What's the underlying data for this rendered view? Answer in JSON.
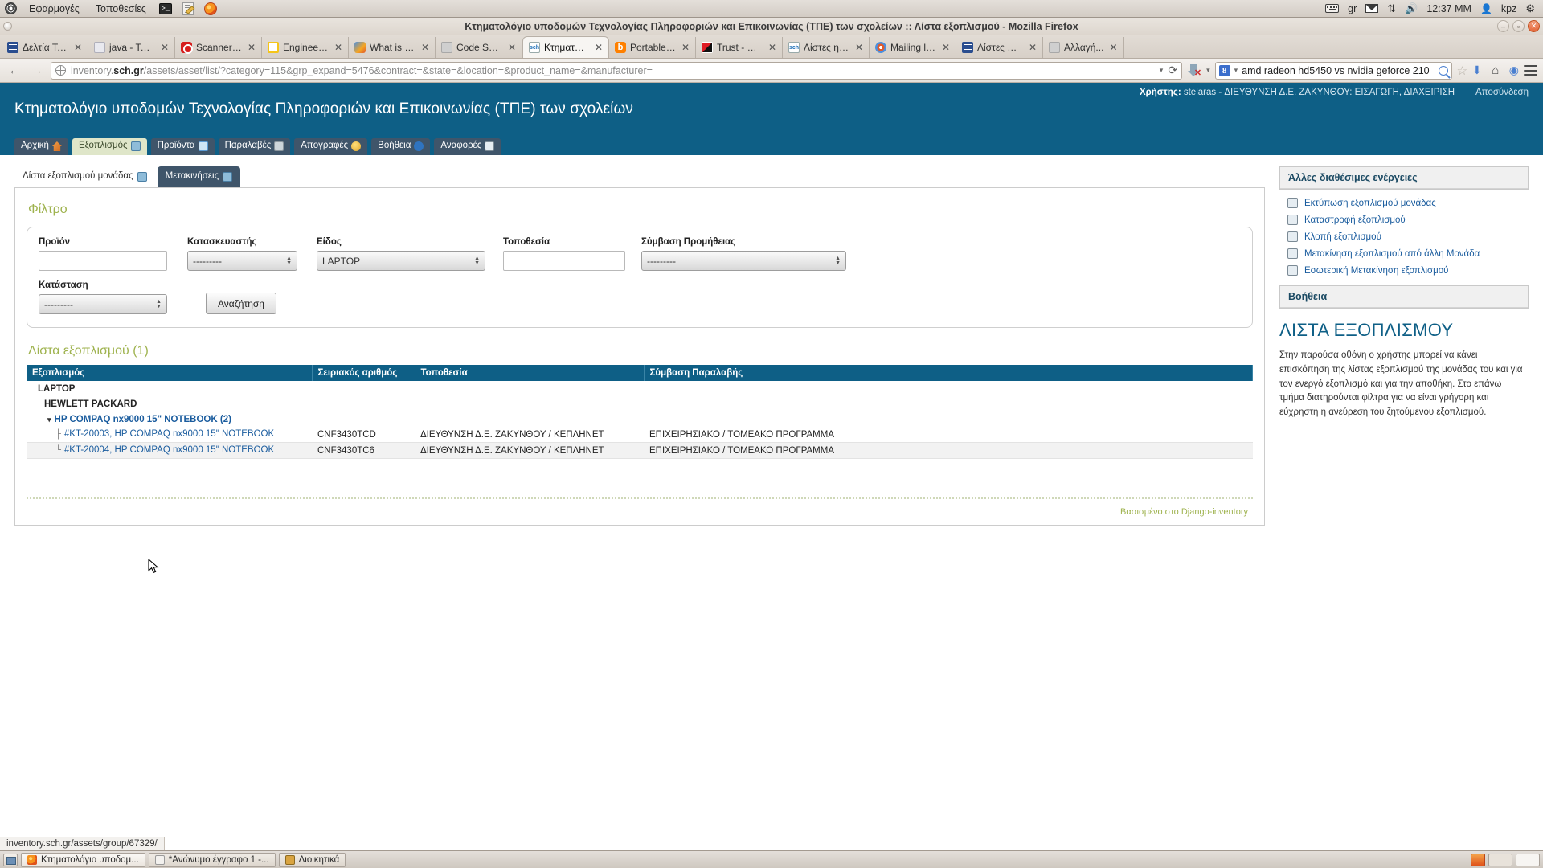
{
  "gnome_panel": {
    "menus": [
      "Εφαρμογές",
      "Τοποθεσίες"
    ],
    "launchers": [
      "terminal-icon",
      "gedit-icon",
      "firefox-icon"
    ],
    "tray": {
      "keyboard_layout": "gr",
      "clock": "12:37 ΜΜ",
      "user": "kpz",
      "icons": [
        "keyboard-icon",
        "mail-icon",
        "network-icon",
        "volume-icon",
        "user-icon",
        "gear-icon"
      ]
    }
  },
  "window": {
    "title": "Κτηματολόγιο υποδομών Τεχνολογίας Πληροφοριών και Επικοινωνίας (ΤΠΕ) των σχολείων :: Λίστα εξοπλισμού - Mozilla Firefox",
    "controls": [
      "minimize",
      "maximize",
      "close"
    ]
  },
  "tabs": [
    {
      "label": "Δελτία Τε...",
      "favicon": "fav-news",
      "active": false
    },
    {
      "label": "java - Take...",
      "favicon": "fav-java",
      "active": false
    },
    {
      "label": "Scanner (J...",
      "favicon": "fav-red",
      "active": false
    },
    {
      "label": "Engineeri...",
      "favicon": "fav-yellow",
      "active": false
    },
    {
      "label": "What is Jo...",
      "favicon": "fav-joomla",
      "active": false
    },
    {
      "label": "Code School -...",
      "favicon": "fav-gray",
      "active": false
    },
    {
      "label": "Κτηματολόγι...",
      "favicon": "fav-sch",
      "active": true
    },
    {
      "label": "Portable ...",
      "favicon": "fav-blogger",
      "active": false
    },
    {
      "label": "Trust - Dig...",
      "favicon": "fav-trust",
      "active": false
    },
    {
      "label": "Λίστες ηλε...",
      "favicon": "fav-sch",
      "active": false
    },
    {
      "label": "Mailing lis...",
      "favicon": "fav-mailman",
      "active": false
    },
    {
      "label": "Λίστες Ηλ...",
      "favicon": "fav-news",
      "active": false
    },
    {
      "label": "Αλλαγή...",
      "favicon": "fav-gray",
      "active": false
    }
  ],
  "tab_close_glyph": "✕",
  "navbar": {
    "back_glyph": "←",
    "forward_glyph": "→",
    "url_prefix": "inventory.",
    "url_domain": "sch.gr",
    "url_suffix": "/assets/asset/list/?category=115&grp_expand=5476&contract=&state=&location=&product_name=&manufacturer=",
    "url_dropdown_glyph": "▾",
    "reload_glyph": "⟳",
    "search_engine": "8",
    "search_value": "amd radeon hd5450 vs nvidia geforce 210",
    "bookmark_glyph": "☆",
    "home_glyph": "⌂",
    "menu_glyph": "≡"
  },
  "app": {
    "title": "Κτηματολόγιο υποδομών Τεχνολογίας Πληροφοριών και Επικοινωνίας (ΤΠΕ) των σχολείων",
    "user_label": "Χρήστης:",
    "user_value": "stelaras - ΔΙΕΥΘΥΝΣΗ Δ.Ε. ΖΑΚΥΝΘΟΥ: ΕΙΣΑΓΩΓΗ, ΔΙΑΧΕΙΡΙΣΗ",
    "logout": "Αποσύνδεση",
    "nav": [
      {
        "label": "Αρχική",
        "icon": "home-icon",
        "icon_class": "mic-home",
        "active": false
      },
      {
        "label": "Εξοπλισμός",
        "icon": "equipment-icon",
        "icon_class": "mic-eq",
        "active": true
      },
      {
        "label": "Προϊόντα",
        "icon": "products-icon",
        "icon_class": "mic-prod",
        "active": false
      },
      {
        "label": "Παραλαβές",
        "icon": "deliveries-icon",
        "icon_class": "mic-del",
        "active": false
      },
      {
        "label": "Απογραφές",
        "icon": "inventory-icon",
        "icon_class": "mic-inv",
        "active": false
      },
      {
        "label": "Βοήθεια",
        "icon": "help-icon",
        "icon_class": "mic-help",
        "active": false
      },
      {
        "label": "Αναφορές",
        "icon": "reports-icon",
        "icon_class": "mic-rep",
        "active": false
      }
    ]
  },
  "subtabs": [
    {
      "label": "Λίστα εξοπλισμού μονάδας",
      "icon": "equipment-list-icon",
      "selected": false
    },
    {
      "label": "Μετακινήσεις",
      "icon": "transfers-icon",
      "selected": true
    }
  ],
  "filter": {
    "heading": "Φίλτρο",
    "fields": [
      {
        "name": "product",
        "label": "Προϊόν",
        "type": "text",
        "value": ""
      },
      {
        "name": "manufacturer",
        "label": "Κατασκευαστής",
        "type": "select",
        "value": "---------"
      },
      {
        "name": "kind",
        "label": "Είδος",
        "type": "select",
        "value": "LAPTOP"
      },
      {
        "name": "location",
        "label": "Τοποθεσία",
        "type": "text",
        "value": ""
      },
      {
        "name": "supply-contract",
        "label": "Σύμβαση Προμήθειας",
        "type": "select",
        "value": "---------"
      },
      {
        "name": "state",
        "label": "Κατάσταση",
        "type": "select",
        "value": "---------"
      }
    ],
    "submit_label": "Αναζήτηση"
  },
  "list": {
    "heading": "Λίστα εξοπλισμού (1)",
    "columns": [
      "Εξοπλισμός",
      "Σειριακός αριθμός",
      "Τοποθεσία",
      "Σύμβαση Παραλαβής"
    ],
    "group_kind": "LAPTOP",
    "group_manufacturer": "HEWLETT PACKARD",
    "group_product": "HP COMPAQ nx9000 15\" NOTEBOOK (2)",
    "group_caret": "▾",
    "rows": [
      {
        "name": "#KT-20003, HP COMPAQ nx9000 15\" NOTEBOOK",
        "serial": "CNF3430TCD",
        "location": "ΔΙΕΥΘΥΝΣΗ Δ.Ε. ΖΑΚΥΝΘΟΥ / ΚΕΠΛΗΝΕΤ",
        "contract": "ΕΠΙΧΕΙΡΗΣΙΑΚΟ / ΤΟΜΕΑΚΟ ΠΡΟΓΡΑΜΜΑ"
      },
      {
        "name": "#KT-20004, HP COMPAQ nx9000 15\" NOTEBOOK",
        "serial": "CNF3430TC6",
        "location": "ΔΙΕΥΘΥΝΣΗ Δ.Ε. ΖΑΚΥΝΘΟΥ / ΚΕΠΛΗΝΕΤ",
        "contract": "ΕΠΙΧΕΙΡΗΣΙΑΚΟ / ΤΟΜΕΑΚΟ ΠΡΟΓΡΑΜΜΑ"
      }
    ]
  },
  "footer": "Βασισμένο στο Django-inventory",
  "sidebar": {
    "actions_title": "Άλλες διαθέσιμες ενέργειες",
    "actions": [
      {
        "label": "Εκτύπωση εξοπλισμού μονάδας",
        "icon": "print-icon"
      },
      {
        "label": "Καταστροφή εξοπλισμού",
        "icon": "destroy-icon"
      },
      {
        "label": "Κλοπή εξοπλισμού",
        "icon": "theft-icon"
      },
      {
        "label": "Μετακίνηση εξοπλισμού από άλλη Μονάδα",
        "icon": "transfer-in-icon"
      },
      {
        "label": "Εσωτερική Μετακίνηση εξοπλισμού",
        "icon": "internal-transfer-icon"
      }
    ],
    "help_title": "Βοήθεια",
    "help_heading": "ΛΙΣΤΑ ΕΞΟΠΛΙΣΜΟΥ",
    "help_body": "Στην παρούσα οθόνη ο χρήστης μπορεί να κάνει επισκόπηση της λίστας εξοπλισμού της μονάδας του και για τον ενεργό εξοπλισμό και για την αποθήκη. Στο επάνω τμήμα διατηρούνται φίλτρα για να είναι γρήγορη και εύχρηστη η ανεύρεση του ζητούμενου εξοπλισμού."
  },
  "statusbar": "inventory.sch.gr/assets/group/67329/",
  "taskbar": {
    "items": [
      {
        "label": "Κτηματολόγιο υποδομ...",
        "icon": "firefox-icon",
        "icon_class": "ti-ff",
        "active": true
      },
      {
        "label": "*Ανώνυμο έγγραφο 1 -...",
        "icon": "document-icon",
        "icon_class": "ti-doc",
        "active": false
      },
      {
        "label": "Διοικητικά",
        "icon": "folder-icon",
        "icon_class": "ti-files",
        "active": false
      }
    ]
  },
  "colors": {
    "brand_blue": "#0e5f86",
    "accent_olive": "#9fb34f",
    "tab_dark": "#3f556a",
    "tab_active_bg": "#dfe6c9",
    "link_blue": "#1a5c9e"
  }
}
